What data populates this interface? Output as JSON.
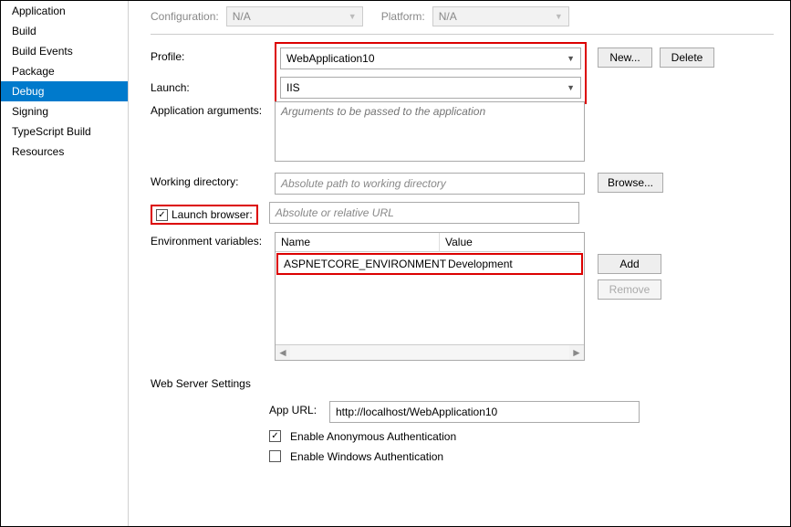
{
  "sidebar": {
    "items": [
      {
        "label": "Application"
      },
      {
        "label": "Build"
      },
      {
        "label": "Build Events"
      },
      {
        "label": "Package"
      },
      {
        "label": "Debug",
        "active": true
      },
      {
        "label": "Signing"
      },
      {
        "label": "TypeScript Build"
      },
      {
        "label": "Resources"
      }
    ]
  },
  "top": {
    "config_label": "Configuration:",
    "config_value": "N/A",
    "platform_label": "Platform:",
    "platform_value": "N/A"
  },
  "form": {
    "profile_label": "Profile:",
    "profile_value": "WebApplication10",
    "new_btn": "New...",
    "delete_btn": "Delete",
    "launch_label": "Launch:",
    "launch_value": "IIS",
    "args_label": "Application arguments:",
    "args_placeholder": "Arguments to be passed to the application",
    "wd_label": "Working directory:",
    "wd_placeholder": "Absolute path to working directory",
    "browse_btn": "Browse...",
    "launch_browser_label": "Launch browser:",
    "launch_browser_checked": true,
    "launch_browser_placeholder": "Absolute or relative URL",
    "env_label": "Environment variables:",
    "env_col1": "Name",
    "env_col2": "Value",
    "env_rows": [
      {
        "name": "ASPNETCORE_ENVIRONMENT",
        "value": "Development"
      }
    ],
    "add_btn": "Add",
    "remove_btn": "Remove"
  },
  "webserver": {
    "title": "Web Server Settings",
    "appurl_label": "App URL:",
    "appurl_value": "http://localhost/WebApplication10",
    "anon_checked": true,
    "anon_label": "Enable Anonymous Authentication",
    "win_checked": false,
    "win_label": "Enable Windows Authentication"
  }
}
